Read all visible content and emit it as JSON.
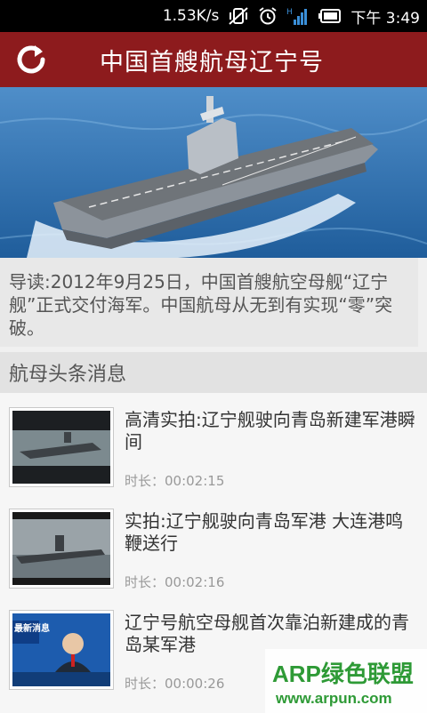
{
  "status_bar": {
    "speed": "1.53K/s",
    "time": "下午 3:49",
    "icons": [
      "mute-vibrate-icon",
      "alarm-icon",
      "signal-icon",
      "battery-icon"
    ]
  },
  "header": {
    "title": "中国首艘航母辽宁号",
    "refresh_icon": "refresh-icon",
    "color": "#8d1b1d"
  },
  "intro": {
    "text": "导读:2012年9月25日，中国首艘航空母舰“辽宁舰”正式交付海军。中国航母从无到有实现“零”突破。"
  },
  "section": {
    "title": "航母头条消息"
  },
  "news": [
    {
      "title": "高清实拍:辽宁舰驶向青岛新建军港瞬间",
      "duration": "时长：00:02:15"
    },
    {
      "title": "实拍:辽宁舰驶向青岛军港 大连港鸣鞭送行",
      "duration": "时长：00:02:16"
    },
    {
      "title": "辽宁号航空母舰首次靠泊新建成的青岛某军港",
      "duration": "时长：00:00:26",
      "thumb_caption": "最新消息"
    }
  ],
  "watermark": {
    "brand": "ARP绿色联盟",
    "url": "www.arpun.com"
  }
}
